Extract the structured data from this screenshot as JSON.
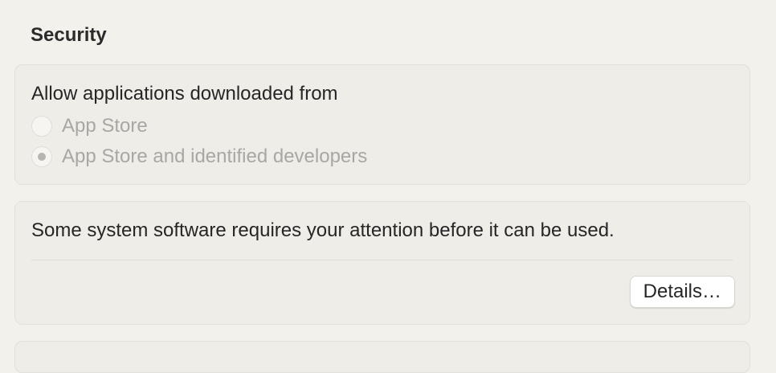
{
  "section": {
    "title": "Security"
  },
  "downloads": {
    "heading": "Allow applications downloaded from",
    "options": [
      {
        "label": "App Store",
        "selected": false,
        "enabled": false
      },
      {
        "label": "App Store and identified developers",
        "selected": true,
        "enabled": false
      }
    ]
  },
  "attention": {
    "message": "Some system software requires your attention before it can be used.",
    "button_label": "Details…"
  },
  "colors": {
    "background": "#f3f1ec",
    "card": "#efede8",
    "text": "#262626",
    "disabled_text": "#a9a7a3"
  }
}
